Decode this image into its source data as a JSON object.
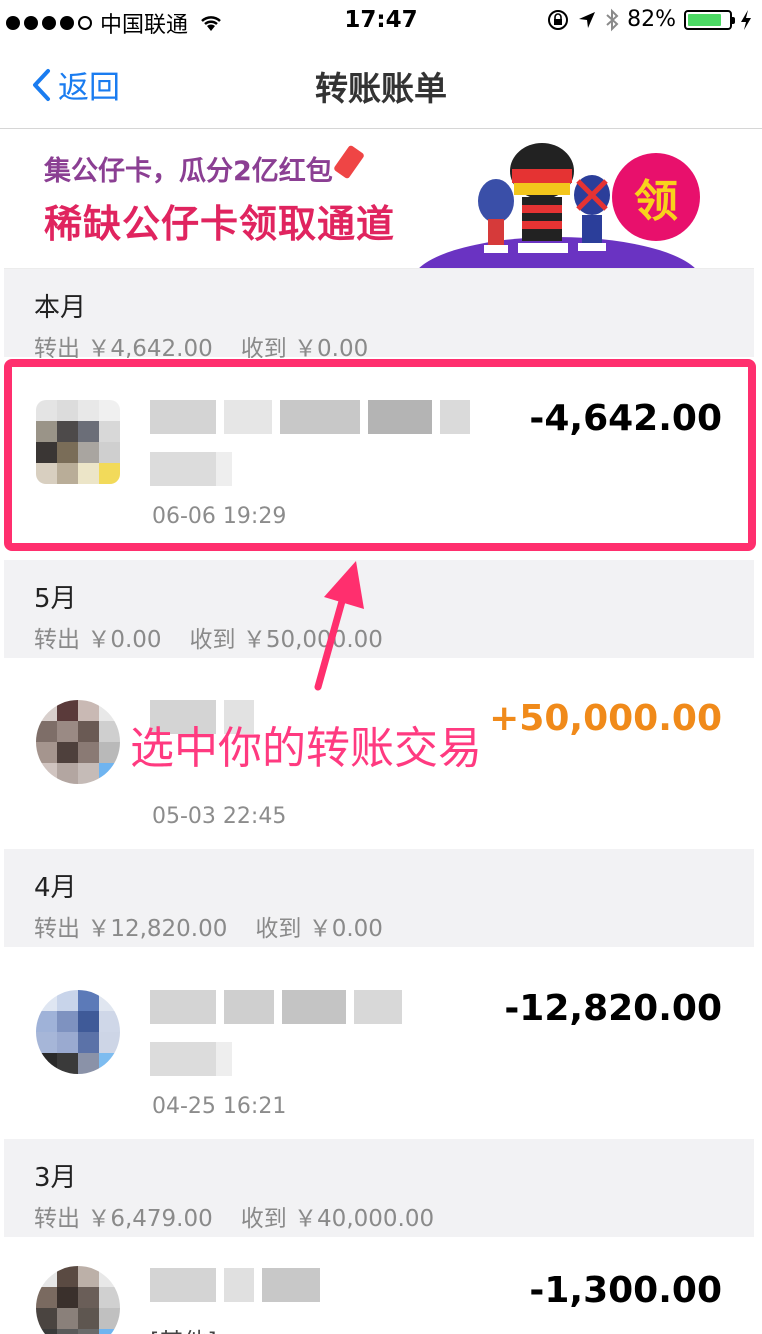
{
  "status_bar": {
    "carrier": "中国联通",
    "time": "17:47",
    "battery": "82%",
    "battery_level": 0.82,
    "icons": [
      "signal-dots-icon",
      "wifi-icon",
      "orientation-lock-icon",
      "location-arrow-icon",
      "bluetooth-icon",
      "battery-icon",
      "charging-bolt-icon"
    ]
  },
  "nav": {
    "back_label": "返回",
    "title": "转账账单"
  },
  "banner": {
    "subtitle": "集公仔卡，瓜分2亿红包",
    "title": "稀缺公仔卡领取通道",
    "badge": "领"
  },
  "sections": [
    {
      "month": "本月",
      "out_label": "转出",
      "out_amount": "￥4,642.00",
      "in_label": "收到",
      "in_amount": "￥0.00",
      "transactions": [
        {
          "date": "06-06  19:29",
          "amount": "-4,642.00"
        }
      ]
    },
    {
      "month": "5月",
      "out_label": "转出",
      "out_amount": "￥0.00",
      "in_label": "收到",
      "in_amount": "￥50,000.00",
      "transactions": [
        {
          "date": "05-03  22:45",
          "amount": "+50,000.00"
        }
      ]
    },
    {
      "month": "4月",
      "out_label": "转出",
      "out_amount": "￥12,820.00",
      "in_label": "收到",
      "in_amount": "￥0.00",
      "transactions": [
        {
          "date": "04-25  16:21",
          "amount": "-12,820.00"
        }
      ]
    },
    {
      "month": "3月",
      "out_label": "转出",
      "out_amount": "￥6,479.00",
      "in_label": "收到",
      "in_amount": "￥40,000.00",
      "transactions": [
        {
          "note": "[其他]",
          "amount": "-1,300.00"
        }
      ]
    }
  ],
  "annotation": {
    "text": "选中你的转账交易",
    "color": "#ff3a80"
  },
  "colors": {
    "accent_blue": "#1a7cf0",
    "income_orange": "#f08a1a",
    "highlight_pink": "#ff2f6e",
    "section_bg": "#f2f2f4"
  }
}
